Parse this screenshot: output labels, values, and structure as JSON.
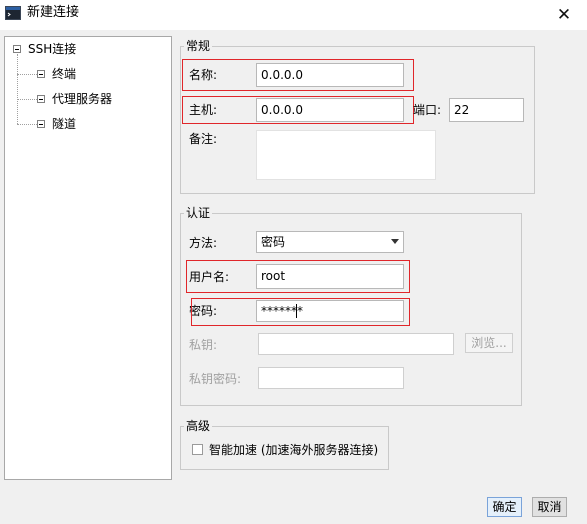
{
  "window": {
    "title": "新建连接",
    "close_glyph": "✕"
  },
  "tree": {
    "root": "SSH连接",
    "children": [
      "终端",
      "代理服务器",
      "隧道"
    ]
  },
  "general": {
    "title": "常规",
    "name_label": "名称:",
    "name_value": "0.0.0.0",
    "host_label": "主机:",
    "host_value": "0.0.0.0",
    "port_label": "端口:",
    "port_value": "22",
    "remark_label": "备注:"
  },
  "auth": {
    "title": "认证",
    "method_label": "方法:",
    "method_value": "密码",
    "username_label": "用户名:",
    "username_value": "root",
    "password_label": "密码:",
    "password_value": "*******",
    "private_key_label": "私钥:",
    "browse_label": "浏览...",
    "key_password_label": "私钥密码:"
  },
  "advanced": {
    "title": "高级",
    "smart_accel_label": "智能加速 (加速海外服务器连接)",
    "smart_accel_checked": false
  },
  "footer": {
    "ok_label": "确定",
    "cancel_label": "取消"
  },
  "colors": {
    "highlight_box": "#e0262a",
    "window_bg": "#f0f0f0",
    "disabled_text": "#a0a0a0"
  },
  "icons": {
    "app": "terminal-window-icon",
    "close": "close-icon",
    "tree_expander": "tree-expander-minus-icon",
    "dropdown": "chevron-down-icon"
  }
}
